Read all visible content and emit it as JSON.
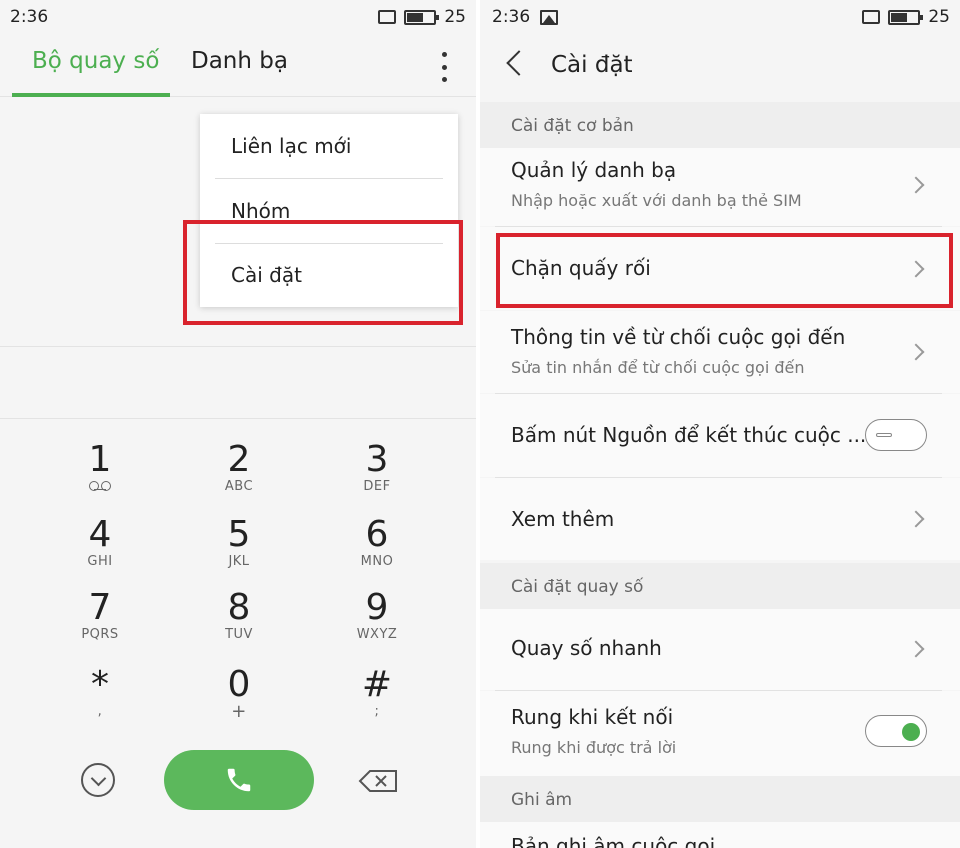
{
  "left": {
    "status": {
      "time": "2:36",
      "battery": "25"
    },
    "tabs": {
      "dialer": "Bộ quay số",
      "contacts": "Danh bạ"
    },
    "menu": {
      "new_contact": "Liên lạc mới",
      "group": "Nhóm",
      "settings": "Cài đặt"
    },
    "keys": [
      {
        "num": "1",
        "letters": ""
      },
      {
        "num": "2",
        "letters": "ABC"
      },
      {
        "num": "3",
        "letters": "DEF"
      },
      {
        "num": "4",
        "letters": "GHI"
      },
      {
        "num": "5",
        "letters": "JKL"
      },
      {
        "num": "6",
        "letters": "MNO"
      },
      {
        "num": "7",
        "letters": "PQRS"
      },
      {
        "num": "8",
        "letters": "TUV"
      },
      {
        "num": "9",
        "letters": "WXYZ"
      },
      {
        "num": "*",
        "letters": ","
      },
      {
        "num": "0",
        "letters": "+"
      },
      {
        "num": "#",
        "letters": ";"
      }
    ]
  },
  "right": {
    "status": {
      "time": "2:36",
      "battery": "25"
    },
    "title": "Cài đặt",
    "sections": {
      "basic": "Cài đặt cơ bản",
      "dial": "Cài đặt quay số",
      "record": "Ghi âm"
    },
    "items": {
      "contacts_mgmt": {
        "title": "Quản lý danh bạ",
        "subtitle": "Nhập hoặc xuất với danh bạ thẻ SIM"
      },
      "block": {
        "title": "Chặn quấy rối"
      },
      "reject_msg": {
        "title": "Thông tin về từ chối cuộc gọi đến",
        "subtitle": "Sửa tin nhắn để từ chối cuộc gọi đến"
      },
      "power_end": {
        "title": "Bấm nút Nguồn để kết thúc cuộc ...",
        "enabled": false
      },
      "more": {
        "title": "Xem thêm"
      },
      "speed_dial": {
        "title": "Quay số nhanh"
      },
      "vibrate": {
        "title": "Rung khi kết nối",
        "subtitle": "Rung khi được trả lời",
        "enabled": true
      },
      "recording": {
        "title": "Bản ghi âm cuộc gọi"
      }
    }
  },
  "colors": {
    "accent": "#4caf50",
    "highlight": "#d9232d",
    "call_button": "#5cb85c"
  }
}
